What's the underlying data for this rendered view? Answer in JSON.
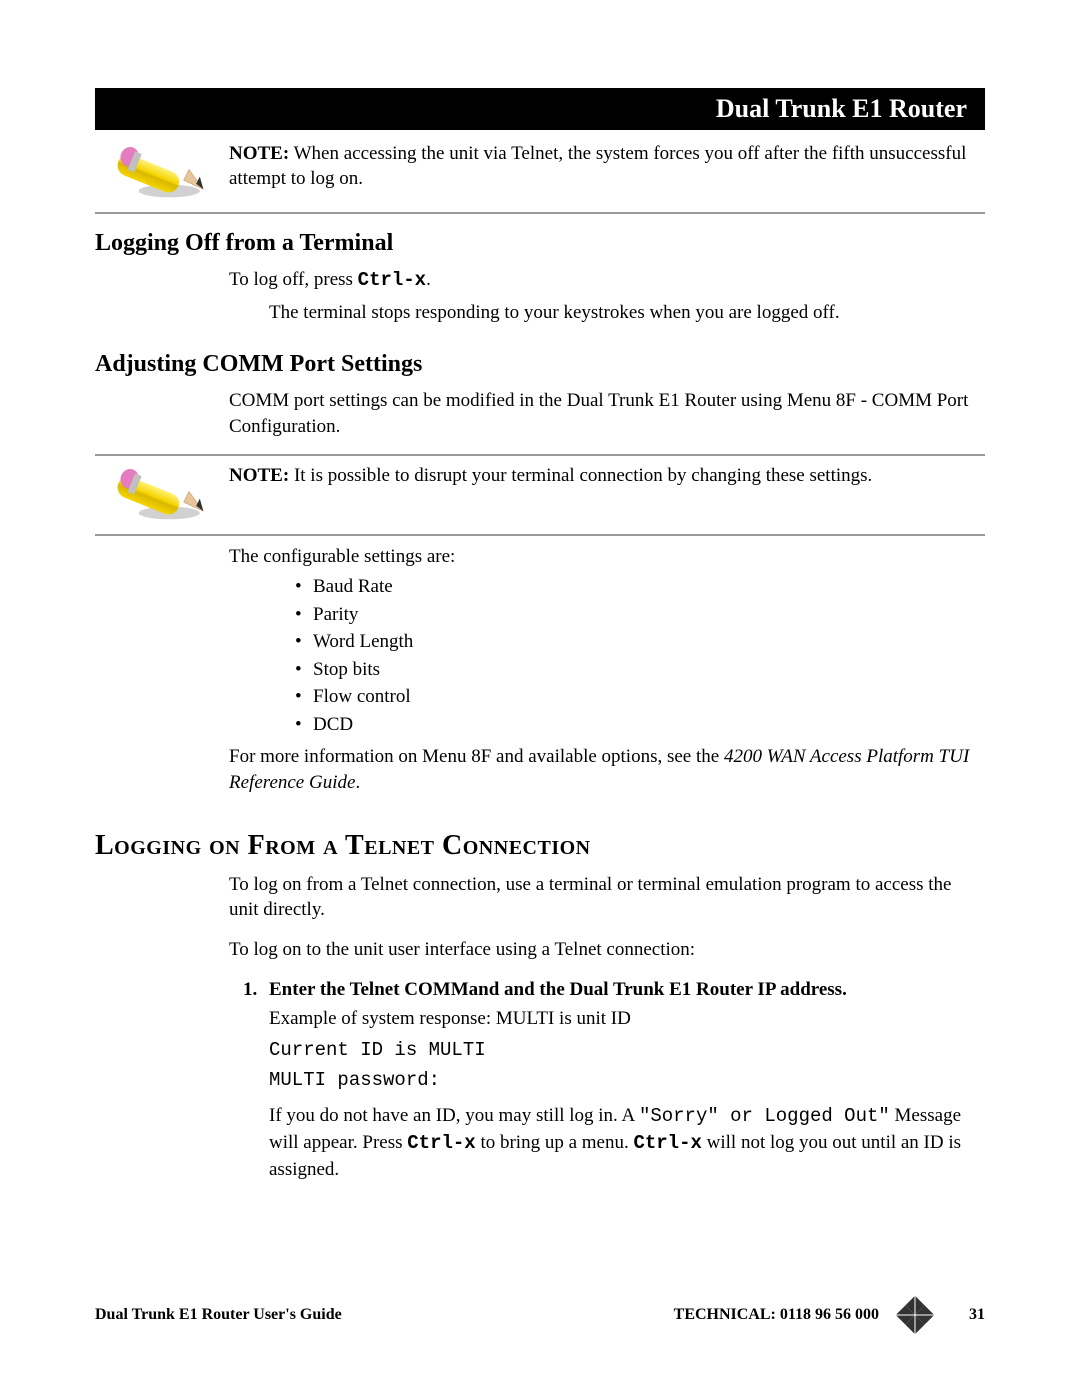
{
  "header": {
    "title": "Dual Trunk E1 Router"
  },
  "note1": {
    "label": "NOTE:",
    "text": " When accessing the unit via Telnet, the system forces you off after the fifth unsuccessful attempt to log on."
  },
  "sec_logoff": {
    "heading": "Logging Off from a Terminal",
    "line1_a": "To log off, press ",
    "line1_cmd": "Ctrl-x",
    "line1_b": ".",
    "line2": "The terminal stops responding to your keystrokes when you are logged off."
  },
  "sec_comm": {
    "heading": "Adjusting COMM Port Settings",
    "para": "COMM port settings can be modified in the Dual Trunk E1 Router using Menu 8F - COMM Port Configuration."
  },
  "note2": {
    "label": "NOTE:",
    "text": " It is possible to disrupt your terminal connection by changing these settings."
  },
  "configurable_intro": "The configurable settings are:",
  "settings": [
    "Baud Rate",
    "Parity",
    "Word Length",
    "Stop bits",
    "Flow control",
    "DCD"
  ],
  "more_info_a": "For more information on Menu 8F and available options, see the ",
  "more_info_ref": "4200 WAN Access Platform TUI Reference Guide",
  "more_info_b": ".",
  "sec_telnet": {
    "heading": "Logging on From a Telnet Connection",
    "para1": "To log on from a Telnet connection, use a terminal or terminal emulation program to access the unit directly.",
    "para2": "To log on to the unit user interface using a Telnet connection:"
  },
  "step1": {
    "num": "1.",
    "bold": "Enter the Telnet COMMand and the Dual Trunk E1 Router IP address.",
    "example": "Example of system response: MULTI is unit ID",
    "code1": "Current ID is MULTI",
    "code2": "MULTI password:",
    "tail_a": "If you do not have an ID, you may still log in. A ",
    "tail_code1": "\"Sorry\" or Logged Out\"",
    "tail_b": " Message will appear. Press ",
    "tail_cmd1": "Ctrl-x",
    "tail_c": " to bring up a menu. ",
    "tail_cmd2": "Ctrl-x",
    "tail_d": " will not log you out until an ID is assigned."
  },
  "footer": {
    "left": "Dual Trunk E1 Router User's Guide",
    "right_label": "TECHNICAL:",
    "right_phone": " 0118 96 56 000",
    "page": "31"
  }
}
